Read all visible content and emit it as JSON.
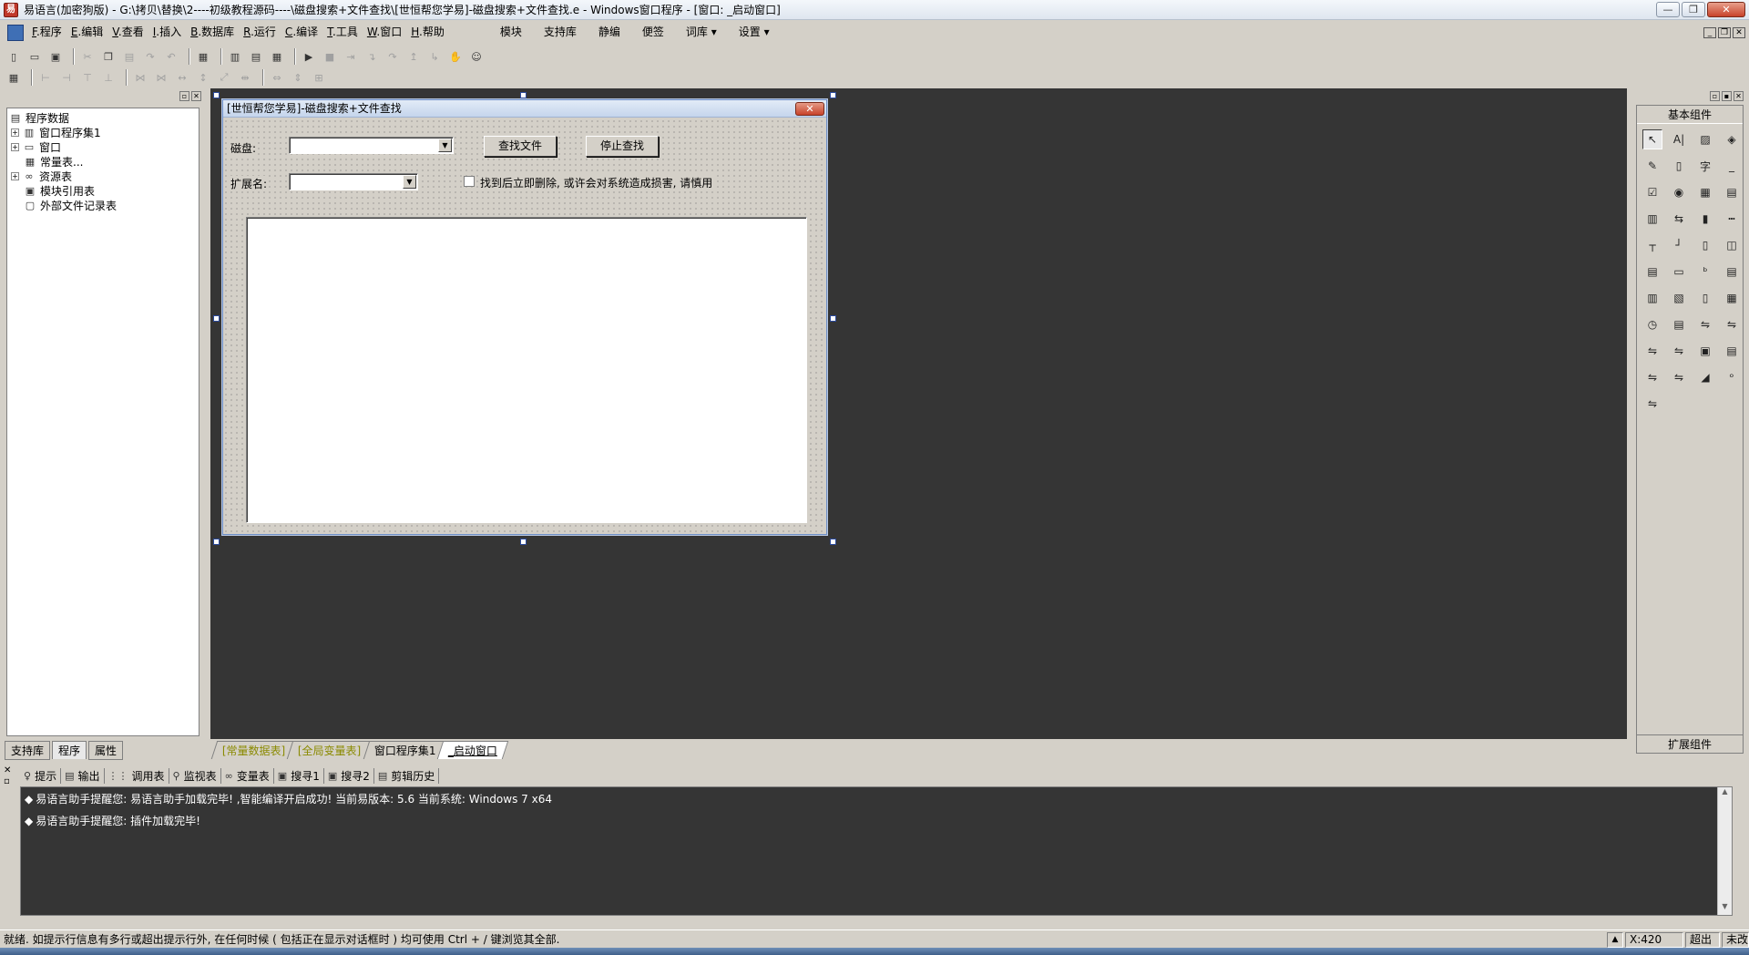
{
  "window": {
    "title": "易语言(加密狗版) - G:\\拷贝\\替换\\2----初级教程源码----\\磁盘搜索+文件查找\\[世恒帮您学易]-磁盘搜索+文件查找.e - Windows窗口程序 - [窗口: _启动窗口]",
    "app_icon": "易",
    "min_glyph": "—",
    "max_glyph": "❐",
    "close_glyph": "✕"
  },
  "menu": {
    "items": [
      {
        "key": "F",
        "label": ".程序"
      },
      {
        "key": "E",
        "label": ".编辑"
      },
      {
        "key": "V",
        "label": ".查看"
      },
      {
        "key": "I",
        "label": ".插入"
      },
      {
        "key": "B",
        "label": ".数据库"
      },
      {
        "key": "R",
        "label": ".运行"
      },
      {
        "key": "C",
        "label": ".编译"
      },
      {
        "key": "T",
        "label": ".工具"
      },
      {
        "key": "W",
        "label": ".窗口"
      },
      {
        "key": "H",
        "label": ".帮助"
      }
    ],
    "extra": [
      "模块",
      "支持库",
      "静编",
      "便签",
      "词库 ▾",
      "设置 ▾"
    ],
    "mdi_min": "_",
    "mdi_restore": "❐",
    "mdi_close": "✕"
  },
  "left_panel": {
    "tree": [
      {
        "label": "程序数据",
        "icon": "database-icon",
        "glyph": "▤",
        "expander": ""
      },
      {
        "label": "窗口程序集1",
        "icon": "class-icon",
        "glyph": "▥",
        "expander": "+"
      },
      {
        "label": "窗口",
        "icon": "window-icon",
        "glyph": "▭",
        "expander": "+"
      },
      {
        "label": "常量表...",
        "icon": "constant-icon",
        "glyph": "▦",
        "expander": ""
      },
      {
        "label": "资源表",
        "icon": "resource-icon",
        "glyph": "∞",
        "expander": "+"
      },
      {
        "label": "模块引用表",
        "icon": "module-icon",
        "glyph": "▣",
        "expander": ""
      },
      {
        "label": "外部文件记录表",
        "icon": "file-icon",
        "glyph": "▢",
        "expander": ""
      }
    ],
    "tabs": [
      "支持库",
      "程序",
      "属性"
    ]
  },
  "form": {
    "title": "[世恒帮您学易]-磁盘搜索+文件查找",
    "close_glyph": "✕",
    "disk_label": "磁盘:",
    "ext_label": "扩展名:",
    "find_button": "查找文件",
    "stop_button": "停止查找",
    "checkbox_label": "找到后立即删除, 或许会对系统造成损害, 请慎用",
    "combo_arrow": "▼"
  },
  "design_tabs": [
    {
      "label": "[常量数据表]",
      "style": "yellow"
    },
    {
      "label": "[全局变量表]",
      "style": "yellow"
    },
    {
      "label": "窗口程序集1",
      "style": "normal"
    },
    {
      "label": "_启动窗口",
      "style": "active"
    }
  ],
  "right_panel": {
    "header": "基本组件",
    "footer": "扩展组件",
    "components": [
      "↖",
      "A|",
      "▨",
      "◈",
      "✎",
      "▯",
      "字",
      "_",
      "☑",
      "◉",
      "▦",
      "▤",
      "▥",
      "⇆",
      "▮",
      "┅",
      "┬",
      "┘",
      "▯",
      "◫",
      "▤",
      "▭",
      "ᵇ",
      "▤",
      "▥",
      "▧",
      "▯",
      "▦",
      "◷",
      "▤",
      "⇋",
      "⇋",
      "⇋",
      "⇋",
      "▣",
      "▤",
      "⇋",
      "⇋",
      "◢",
      "ᵒ",
      "⇋"
    ]
  },
  "bottom_panel": {
    "tabs": [
      {
        "label": "提示",
        "icon": "bulb-icon",
        "glyph": "♀"
      },
      {
        "label": "输出",
        "icon": "output-icon",
        "glyph": "▤"
      },
      {
        "label": "调用表",
        "icon": "callstack-icon",
        "glyph": "⋮⋮"
      },
      {
        "label": "监视表",
        "icon": "watch-icon",
        "glyph": "⚲"
      },
      {
        "label": "变量表",
        "icon": "variables-icon",
        "glyph": "∞"
      },
      {
        "label": "搜寻1",
        "icon": "search1-icon",
        "glyph": "▣"
      },
      {
        "label": "搜寻2",
        "icon": "search2-icon",
        "glyph": "▣"
      },
      {
        "label": "剪辑历史",
        "icon": "clipboard-icon",
        "glyph": "▤"
      }
    ],
    "output_lines": [
      "易语言助手提醒您: 易语言助手加载完毕!  ,智能编译开启成功!  当前易版本: 5.6  当前系统: Windows 7 x64",
      "易语言助手提醒您: 插件加载完毕!"
    ]
  },
  "status": {
    "text": "就绪. 如提示行信息有多行或超出提示行外, 在任何时候 ( 包括正在显示对话框时 ) 均可使用 Ctrl + / 键浏览其全部.",
    "x_readout": "X:420",
    "overwrite": "超出",
    "modified": "未改"
  }
}
